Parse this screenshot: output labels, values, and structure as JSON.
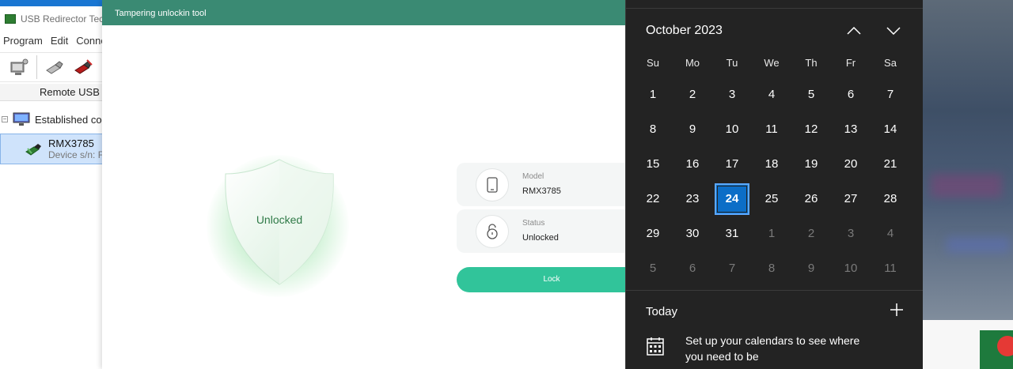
{
  "usb_window": {
    "title": "USB Redirector Tec",
    "menu": [
      "Program",
      "Edit",
      "Conne"
    ],
    "tab_label": "Remote USB",
    "tree_root": "Established con",
    "device_name": "RMX3785",
    "device_sub": "Device s/n: F"
  },
  "tool_window": {
    "title": "Tampering unlockin tool",
    "shield_label": "Unlocked",
    "model_label": "Model",
    "model_value": "RMX3785",
    "status_label": "Status",
    "status_value": "Unlocked",
    "lock_button": "Lock",
    "accent_color": "#31c49a",
    "header_color": "#3a8a73"
  },
  "calendar": {
    "month_title": "October 2023",
    "weekdays": [
      "Su",
      "Mo",
      "Tu",
      "We",
      "Th",
      "Fr",
      "Sa"
    ],
    "weeks": [
      [
        {
          "d": "1"
        },
        {
          "d": "2"
        },
        {
          "d": "3"
        },
        {
          "d": "4"
        },
        {
          "d": "5"
        },
        {
          "d": "6"
        },
        {
          "d": "7"
        }
      ],
      [
        {
          "d": "8"
        },
        {
          "d": "9"
        },
        {
          "d": "10"
        },
        {
          "d": "11"
        },
        {
          "d": "12"
        },
        {
          "d": "13"
        },
        {
          "d": "14"
        }
      ],
      [
        {
          "d": "15"
        },
        {
          "d": "16"
        },
        {
          "d": "17"
        },
        {
          "d": "18"
        },
        {
          "d": "19"
        },
        {
          "d": "20"
        },
        {
          "d": "21"
        }
      ],
      [
        {
          "d": "22"
        },
        {
          "d": "23"
        },
        {
          "d": "24",
          "today": true
        },
        {
          "d": "25"
        },
        {
          "d": "26"
        },
        {
          "d": "27"
        },
        {
          "d": "28"
        }
      ],
      [
        {
          "d": "29"
        },
        {
          "d": "30"
        },
        {
          "d": "31"
        },
        {
          "d": "1",
          "muted": true
        },
        {
          "d": "2",
          "muted": true
        },
        {
          "d": "3",
          "muted": true
        },
        {
          "d": "4",
          "muted": true
        }
      ],
      [
        {
          "d": "5",
          "muted": true
        },
        {
          "d": "6",
          "muted": true
        },
        {
          "d": "7",
          "muted": true
        },
        {
          "d": "8",
          "muted": true
        },
        {
          "d": "9",
          "muted": true
        },
        {
          "d": "10",
          "muted": true
        },
        {
          "d": "11",
          "muted": true
        }
      ]
    ],
    "today_label": "Today",
    "setup_text": "Set up your calendars to see where you need to be",
    "selected_color": "#0c6ec7"
  }
}
